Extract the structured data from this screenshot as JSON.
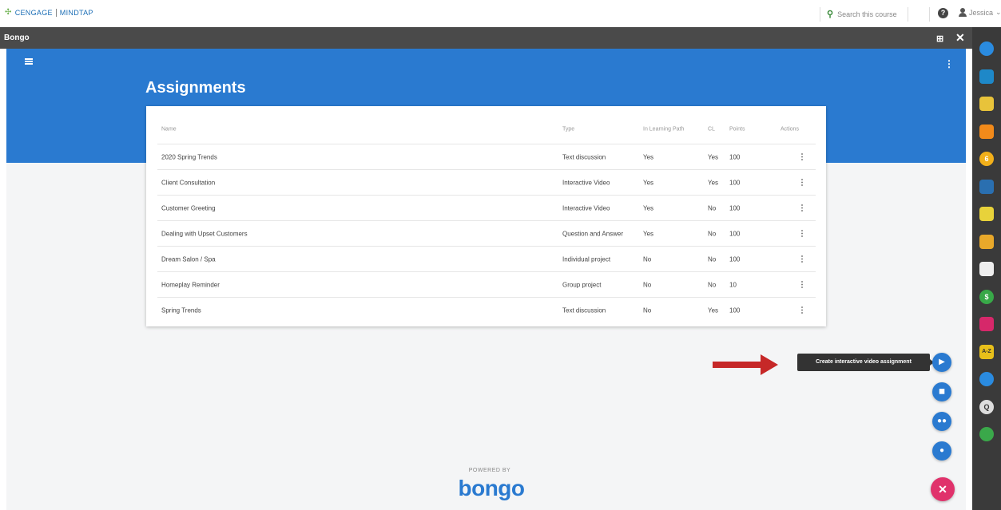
{
  "header": {
    "brand_left": "CENGAGE",
    "brand_right": "MINDTAP",
    "search_placeholder": "Search this course",
    "user_name": "Jessica"
  },
  "frame": {
    "title": "Bongo"
  },
  "page": {
    "title": "Assignments"
  },
  "table": {
    "columns": [
      "Name",
      "Type",
      "In Learning Path",
      "CL",
      "Points",
      "Actions"
    ],
    "rows": [
      {
        "name": "2020 Spring Trends",
        "type": "Text discussion",
        "learning_path": "Yes",
        "cl": "Yes",
        "points": "100"
      },
      {
        "name": "Client Consultation",
        "type": "Interactive Video",
        "learning_path": "Yes",
        "cl": "Yes",
        "points": "100"
      },
      {
        "name": "Customer Greeting",
        "type": "Interactive Video",
        "learning_path": "Yes",
        "cl": "No",
        "points": "100"
      },
      {
        "name": "Dealing with Upset Customers",
        "type": "Question and Answer",
        "learning_path": "Yes",
        "cl": "No",
        "points": "100"
      },
      {
        "name": "Dream Salon / Spa",
        "type": "Individual project",
        "learning_path": "No",
        "cl": "No",
        "points": "100"
      },
      {
        "name": "Homeplay Reminder",
        "type": "Group project",
        "learning_path": "No",
        "cl": "No",
        "points": "10"
      },
      {
        "name": "Spring Trends",
        "type": "Text discussion",
        "learning_path": "No",
        "cl": "Yes",
        "points": "100"
      }
    ]
  },
  "tooltip": {
    "text": "Create interactive video assignment"
  },
  "footer": {
    "powered_by": "POWERED BY",
    "brand": "bongo"
  },
  "colors": {
    "primary": "#2a7ad0",
    "close_fab": "#e0326b",
    "arrow": "#c62828",
    "frame_bar": "#4a4a4a",
    "dock": "#3a3a3a"
  },
  "dock_icons": [
    {
      "name": "bongo-app-icon",
      "color": "#2a8be0"
    },
    {
      "name": "briefcase-icon",
      "color": "#1e88c8"
    },
    {
      "name": "pencil-icon",
      "color": "#e8c33a"
    },
    {
      "name": "rss-icon",
      "color": "#f28a1a"
    },
    {
      "name": "number-six-icon",
      "color": "#f2b01a"
    },
    {
      "name": "book-icon",
      "color": "#2a6fb0"
    },
    {
      "name": "notepad-icon",
      "color": "#e8d23a"
    },
    {
      "name": "sparkle-icon",
      "color": "#e8a82a"
    },
    {
      "name": "chat-icon",
      "color": "#eeeeee"
    },
    {
      "name": "dollar-icon",
      "color": "#38a848"
    },
    {
      "name": "monitor-icon",
      "color": "#d6286a"
    },
    {
      "name": "dictionary-icon",
      "color": "#e8c01a"
    },
    {
      "name": "analytics-icon",
      "color": "#2a8be0"
    },
    {
      "name": "quiz-icon",
      "color": "#dddddd"
    },
    {
      "name": "ring-icon",
      "color": "#3aa84a"
    }
  ]
}
